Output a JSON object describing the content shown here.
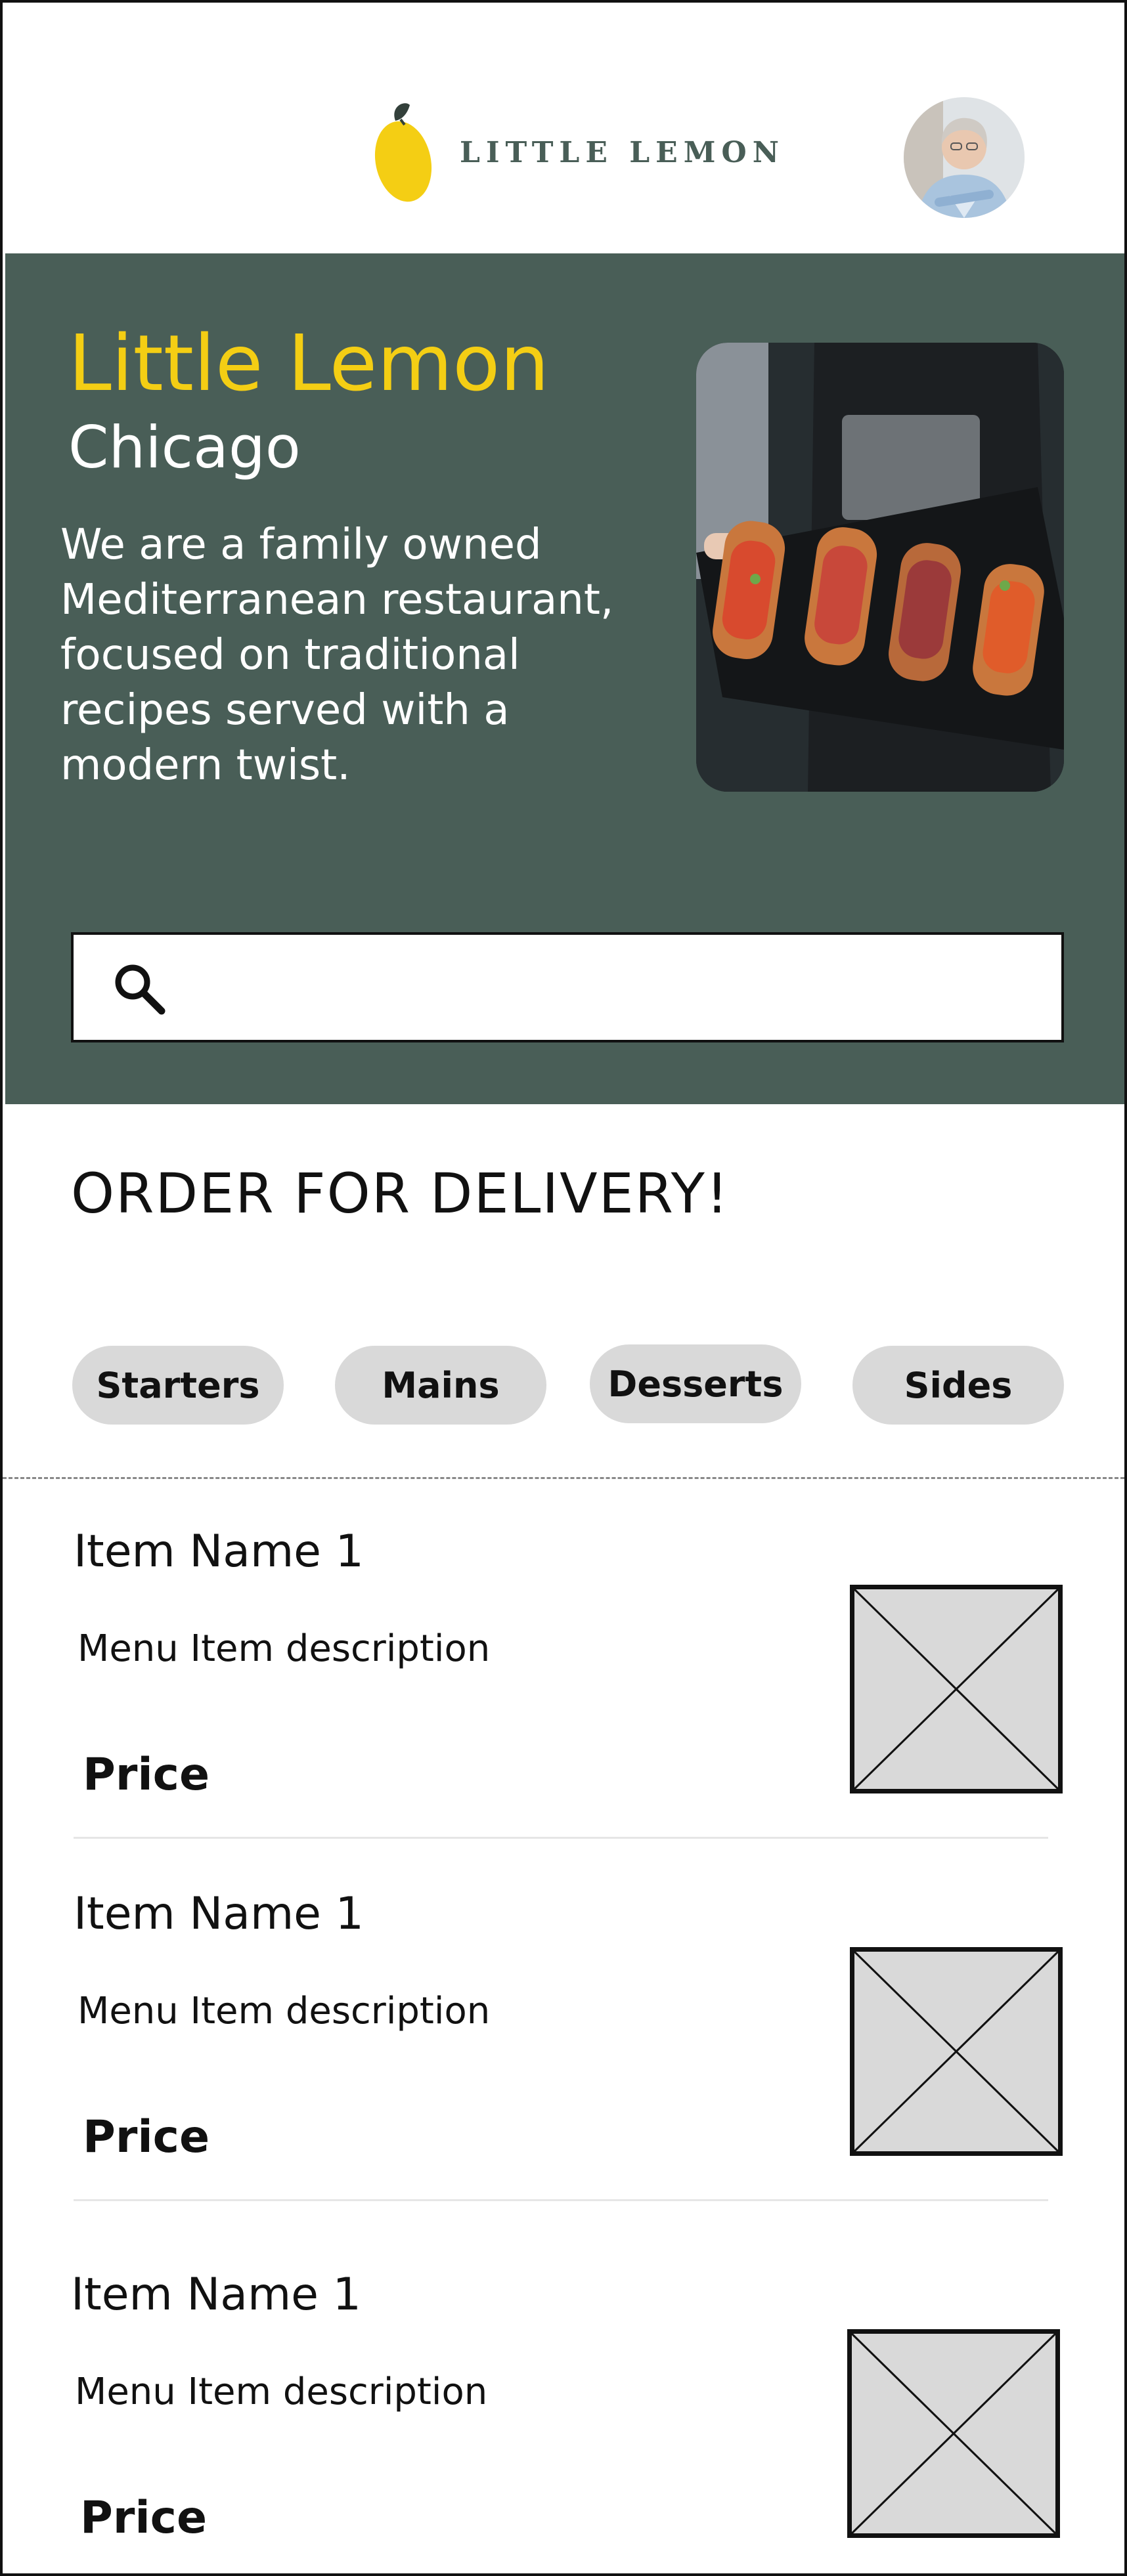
{
  "header": {
    "logo_text": "LITTLE LEMON",
    "logo_icon": "lemon-icon",
    "avatar_icon": "user-avatar"
  },
  "hero": {
    "title": "Little Lemon",
    "subtitle": "Chicago",
    "description": "We are a family owned Mediterranean restaurant, focused on traditional recipes served with a modern twist.",
    "search_icon": "search-icon",
    "search_value": ""
  },
  "order": {
    "title": "ORDER FOR DELIVERY!",
    "categories": [
      "Starters",
      "Mains",
      "Desserts",
      "Sides"
    ]
  },
  "menu_items": [
    {
      "name": "Item Name 1",
      "description": "Menu Item description",
      "price": "Price"
    },
    {
      "name": "Item Name 1",
      "description": "Menu Item description",
      "price": "Price"
    },
    {
      "name": "Item Name 1",
      "description": "Menu Item description",
      "price": "Price"
    }
  ],
  "colors": {
    "primary_green": "#495e57",
    "primary_yellow": "#f4ce14",
    "chip_gray": "#d9d9d9"
  }
}
